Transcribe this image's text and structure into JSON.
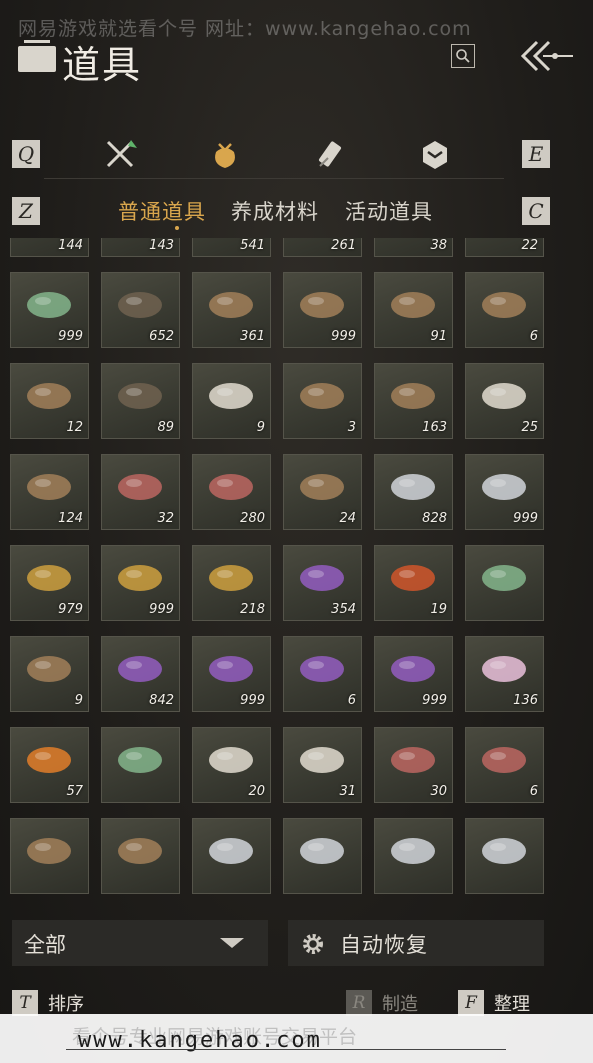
{
  "watermark": {
    "top": "网易游戏就选看个号   网址：www.kangehao.com",
    "bottom_faded": "看个号专业网易游戏账号交易平台",
    "bottom_url": "www.kangehao.com"
  },
  "header": {
    "title": "道具"
  },
  "categories": {
    "left_key": "Q",
    "right_key": "E",
    "icons": [
      "weapons-icon",
      "item-bag-icon",
      "scroll-icon",
      "badge-icon"
    ],
    "active_index": 1
  },
  "sub_tabs": {
    "left_key": "Z",
    "right_key": "C",
    "tabs": [
      "普通道具",
      "养成材料",
      "活动道具"
    ],
    "active_index": 0
  },
  "inventory": {
    "rows": [
      [
        {
          "icon": "worm-icon",
          "qty": "144"
        },
        {
          "icon": "sack-icon",
          "qty": "143"
        },
        {
          "icon": "needles-icon",
          "qty": "541"
        },
        {
          "icon": "arrows-icon",
          "qty": "261"
        },
        {
          "icon": "log-pile-icon",
          "qty": "38"
        },
        {
          "icon": "log-pile-icon",
          "qty": "22"
        }
      ],
      [
        {
          "icon": "bamboo-bundle-icon",
          "qty": "999"
        },
        {
          "icon": "dark-log-pile-icon",
          "qty": "652"
        },
        {
          "icon": "log-pile-icon",
          "qty": "361"
        },
        {
          "icon": "log-pile-icon",
          "qty": "999"
        },
        {
          "icon": "log-pile-icon",
          "qty": "91"
        },
        {
          "icon": "log-pile-icon",
          "qty": "6"
        }
      ],
      [
        {
          "icon": "log-pile-icon",
          "qty": "12"
        },
        {
          "icon": "dark-log-pile-icon",
          "qty": "89"
        },
        {
          "icon": "pale-log-pile-icon",
          "qty": "9"
        },
        {
          "icon": "log-pile-icon",
          "qty": "3"
        },
        {
          "icon": "red-log-pile-icon",
          "qty": "163"
        },
        {
          "icon": "feathers-icon",
          "qty": "25"
        }
      ],
      [
        {
          "icon": "hide-icon",
          "qty": "124"
        },
        {
          "icon": "entrails-icon",
          "qty": "32"
        },
        {
          "icon": "raw-meat-icon",
          "qty": "280"
        },
        {
          "icon": "carp-icon",
          "qty": "24"
        },
        {
          "icon": "silver-fish-icon",
          "qty": "828"
        },
        {
          "icon": "silver-fish-icon",
          "qty": "999"
        }
      ],
      [
        {
          "icon": "golden-fish-icon",
          "qty": "979"
        },
        {
          "icon": "golden-fish-icon",
          "qty": "999"
        },
        {
          "icon": "gold-ore-icon",
          "qty": "218"
        },
        {
          "icon": "amethyst-icon",
          "qty": "354"
        },
        {
          "icon": "red-gem-icon",
          "qty": "19"
        },
        {
          "icon": "white-herb-icon",
          "qty": ""
        }
      ],
      [
        {
          "icon": "mortar-icon",
          "qty": "9"
        },
        {
          "icon": "purple-flower-icon",
          "qty": "842"
        },
        {
          "icon": "purple-flower-icon",
          "qty": "999"
        },
        {
          "icon": "lavender-icon",
          "qty": "6"
        },
        {
          "icon": "lavender-icon",
          "qty": "999"
        },
        {
          "icon": "pink-blossom-icon",
          "qty": "136"
        }
      ],
      [
        {
          "icon": "orange-flower-icon",
          "qty": "57"
        },
        {
          "icon": "jade-stone-icon",
          "qty": ""
        },
        {
          "icon": "white-feather-icon",
          "qty": "20"
        },
        {
          "icon": "grey-feather-icon",
          "qty": "31"
        },
        {
          "icon": "meat-slices-icon",
          "qty": "30"
        },
        {
          "icon": "meat-slices-icon",
          "qty": "6"
        }
      ],
      [
        {
          "icon": "sponge-icon",
          "qty": ""
        },
        {
          "icon": "quills-icon",
          "qty": ""
        },
        {
          "icon": "salt-icon",
          "qty": ""
        },
        {
          "icon": "pufferfish-icon",
          "qty": ""
        },
        {
          "icon": "rockfish-icon",
          "qty": ""
        },
        {
          "icon": "striped-fish-icon",
          "qty": ""
        }
      ]
    ]
  },
  "filter": {
    "value": "全部"
  },
  "auto_restore": {
    "label": "自动恢复"
  },
  "actions": [
    {
      "key": "T",
      "label": "排序",
      "enabled": true
    },
    {
      "key": "R",
      "label": "制造",
      "enabled": false
    },
    {
      "key": "F",
      "label": "整理",
      "enabled": true
    }
  ],
  "colors": {
    "accent": "#d9a64d",
    "cell_bg": "#3a3b32",
    "background": "#1f1d1a"
  }
}
